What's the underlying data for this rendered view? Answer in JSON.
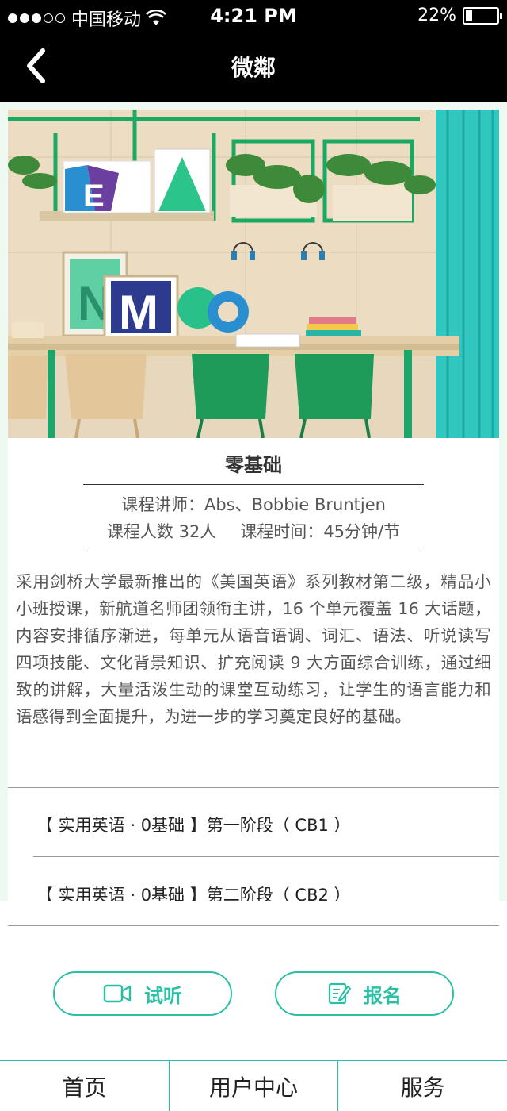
{
  "status_bar": {
    "carrier": "中国移动",
    "time": "4:21 PM",
    "battery": "22%",
    "battery_level": 0.22,
    "signal_bars_filled": 3,
    "signal_bars_total": 5
  },
  "nav": {
    "title": "微鄰",
    "back_icon": "chevron-left-icon"
  },
  "course": {
    "title": "零基础",
    "teacher_line": "课程讲师：Abs、Bobbie Bruntjen",
    "count_label": "课程人数",
    "count_value": "32人",
    "time_label": "课程时间：",
    "time_value": "45分钟/节",
    "description": "采用剑桥大学最新推出的《美国英语》系列教材第二级，精品小小班授课，新航道名师团领衔主讲，16 个单元覆盖 16 大话题，内容安排循序渐进，每单元从语音语调、词汇、语法、听说读写四项技能、文化背景知识、扩充阅读 9 大方面综合训练，通过细致的讲解，大量活泼生动的课堂互动练习，让学生的语言能力和语感得到全面提升，为进一步的学习奠定良好的基础。"
  },
  "stages": [
    {
      "label": "【 实用英语 · 0基础 】第一阶段（ CB1 ）"
    },
    {
      "label": "【 实用英语 · 0基础 】第二阶段（ CB2 ）"
    }
  ],
  "actions": {
    "trial_label": "试听",
    "trial_icon": "video-camera-icon",
    "enroll_label": "报名",
    "enroll_icon": "edit-form-icon"
  },
  "tabs": [
    {
      "label": "首页"
    },
    {
      "label": "用户中心"
    },
    {
      "label": "服务"
    }
  ],
  "colors": {
    "accent": "#2bbfa4",
    "bar_bg": "#000000",
    "page_bg": "#eefaf1"
  }
}
